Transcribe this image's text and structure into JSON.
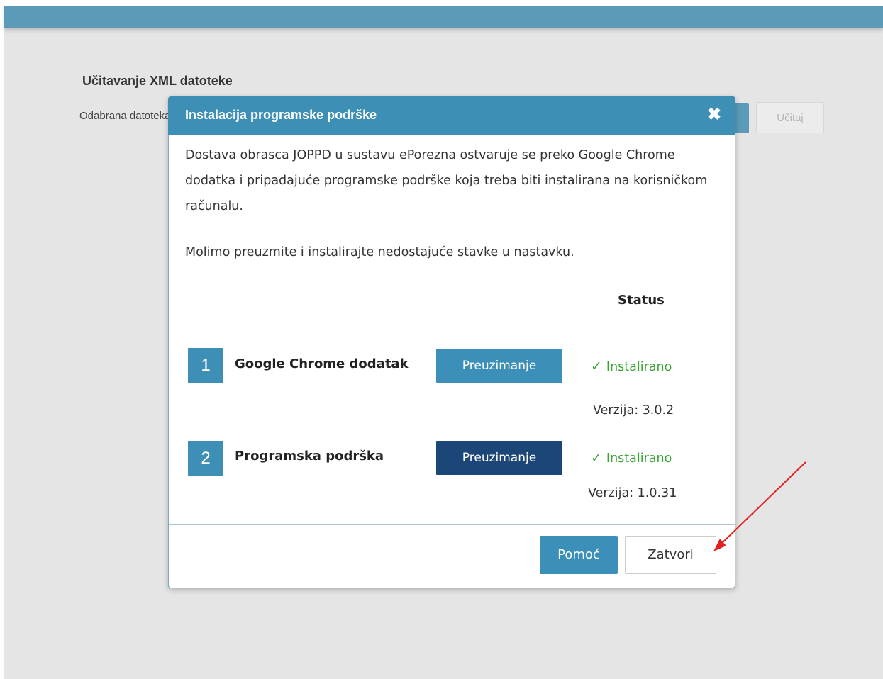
{
  "page": {
    "section_title": "Učitavanje XML datoteke",
    "file_label": "Odabrana datoteka",
    "load_button": "Učitaj"
  },
  "modal": {
    "title": "Instalacija programske podrške",
    "close_symbol": "✖",
    "intro_text": "Dostava obrasca JOPPD u sustavu ePorezna ostvaruje se preko Google Chrome dodatka i pripadajuće programske podrške koja treba biti instalirana na korisničkom računalu.",
    "instruction_text": "Molimo preuzmite i instalirajte nedostajuće stavke u nastavku.",
    "status_header": "Status",
    "items": [
      {
        "number": "1",
        "label": "Google Chrome dodatak",
        "download_label": "Preuzimanje",
        "status": "Instalirano",
        "version": "Verzija: 3.0.2"
      },
      {
        "number": "2",
        "label": "Programska podrška",
        "download_label": "Preuzimanje",
        "status": "Instalirano",
        "version": "Verzija: 1.0.31"
      }
    ],
    "help_button": "Pomoć",
    "close_button": "Zatvori"
  },
  "colors": {
    "header": "#3d8fb5",
    "button_primary": "#3b8fb8",
    "button_dark": "#1c4677",
    "status_ok": "#3aa535",
    "annotation_arrow": "#e32020"
  }
}
